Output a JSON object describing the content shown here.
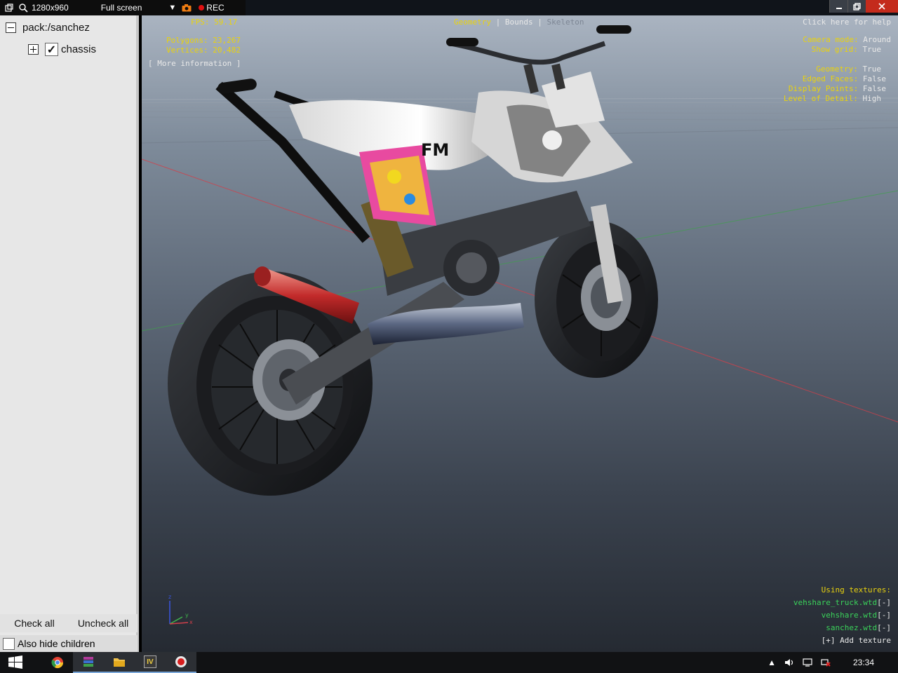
{
  "recorder": {
    "resolution": "1280x960",
    "mode_label": "Full screen",
    "rec_label": "REC"
  },
  "tree": {
    "root_label": "pack:/sanchez",
    "child_label": "chassis",
    "child_checked": true
  },
  "panel_buttons": {
    "check_all": "Check all",
    "uncheck_all": "Uncheck all",
    "also_hide_children": "Also hide children"
  },
  "stats": {
    "fps_label": "FPS:",
    "fps_value": "59.17",
    "polygons_label": "Polygons:",
    "polygons_value": "23,267",
    "vertices_label": "Vertices:",
    "vertices_value": "20,482",
    "more_info": "[ More information ]"
  },
  "view_tabs": {
    "geometry": "Geometry",
    "bounds": "Bounds",
    "skeleton": "Skeleton",
    "separator": "|"
  },
  "help_link": "Click here for help",
  "settings": [
    {
      "label": "Camera mode:",
      "value": "Around"
    },
    {
      "label": "Show grid:",
      "value": "True"
    },
    {
      "label": "Geometry:",
      "value": "True"
    },
    {
      "label": "Edged Faces:",
      "value": "False"
    },
    {
      "label": "Display Points:",
      "value": "False"
    },
    {
      "label": "Level of Detail:",
      "value": "High"
    }
  ],
  "textures": {
    "header": "Using textures:",
    "items": [
      {
        "name": "vehshare_truck.wtd",
        "action": "[-]"
      },
      {
        "name": "vehshare.wtd",
        "action": "[-]"
      },
      {
        "name": "sanchez.wtd",
        "action": "[-]"
      }
    ],
    "add_label": "[+] Add texture"
  },
  "model_decal_text": "FM",
  "axes": {
    "x": "x",
    "y": "y",
    "z": "z"
  },
  "taskbar": {
    "clock": "23:34",
    "app_viewer_label": "IV"
  },
  "colors": {
    "hud_key": "#e9d20e",
    "hud_value": "#e8e8e8",
    "texture_link": "#3ad25a",
    "panel_bg": "#e7e7e7"
  }
}
